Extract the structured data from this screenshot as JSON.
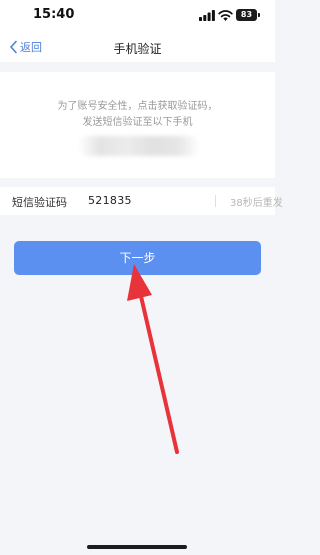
{
  "status_bar": {
    "time": "15:40",
    "battery": "83",
    "icons": [
      "signal-icon",
      "wifi-icon",
      "battery-icon"
    ]
  },
  "nav": {
    "back_label": "返回",
    "title": "手机验证",
    "back_icon": "chevron-left-icon"
  },
  "info": {
    "line1": "为了账号安全性，点击获取验证码，",
    "line2": "发送短信验证至以下手机"
  },
  "sms": {
    "label": "短信验证码",
    "code": "521835",
    "resend": "38秒后重发"
  },
  "next_button": {
    "label": "下一步"
  },
  "colors": {
    "accent": "#5b8ff0",
    "link": "#4f7fd9",
    "page_background": "#f4f5f9",
    "annotation_arrow": "#e8333a"
  }
}
